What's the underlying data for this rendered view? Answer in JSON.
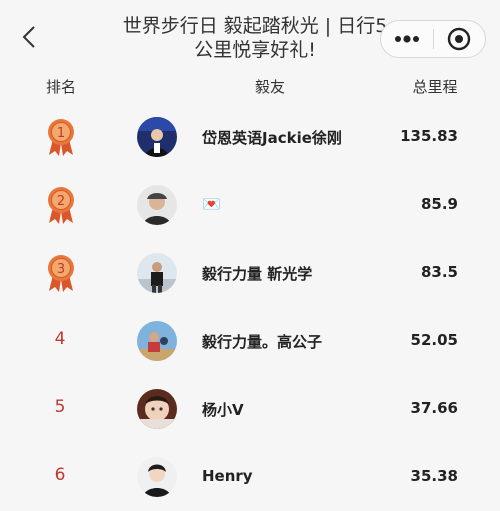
{
  "topbar": {
    "title": "世界步行日 毅起踏秋光 | 日行5公里悦享好礼!",
    "back_icon": "chevron-left-icon",
    "more_icon": "more-dots-icon",
    "close_icon": "target-close-icon"
  },
  "table": {
    "headers": {
      "rank": "排名",
      "name": "毅友",
      "distance": "总里程"
    },
    "rows": [
      {
        "rank": "1",
        "medal": true,
        "name": "岱恩英语Jackie徐刚",
        "distance": "135.83"
      },
      {
        "rank": "2",
        "medal": true,
        "name": "💌",
        "distance": "85.9"
      },
      {
        "rank": "3",
        "medal": true,
        "name": "毅行力量 靳光学",
        "distance": "83.5"
      },
      {
        "rank": "4",
        "medal": false,
        "name": "毅行力量。高公子",
        "distance": "52.05"
      },
      {
        "rank": "5",
        "medal": false,
        "name": "杨小V",
        "distance": "37.66"
      },
      {
        "rank": "6",
        "medal": false,
        "name": "Henry",
        "distance": "35.38"
      }
    ]
  },
  "colors": {
    "rank_text": "#c0392b",
    "medal": "#e8783a",
    "background": "#f7f6f6"
  }
}
